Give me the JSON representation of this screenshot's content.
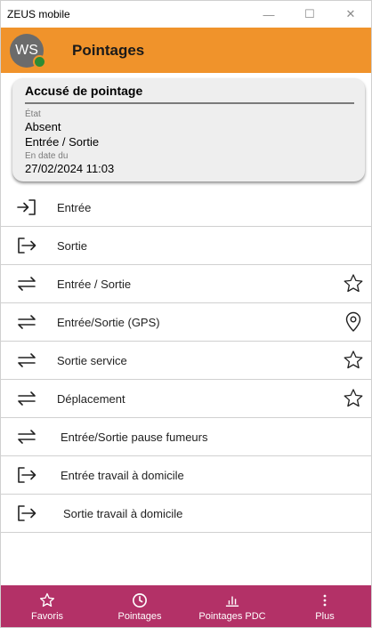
{
  "window": {
    "title": "ZEUS mobile",
    "controls": {
      "minimize": "—",
      "maximize": "☐",
      "close": "✕"
    }
  },
  "header": {
    "avatar_initials": "WS",
    "title": "Pointages",
    "bg_color": "#f0932b",
    "presence_color": "#2e8b33"
  },
  "card": {
    "title": "Accusé de pointage",
    "etat_label": "État",
    "etat_value": "Absent",
    "type_value": "Entrée / Sortie",
    "date_label": "En date du",
    "date_value": "27/02/2024 11:03"
  },
  "actions": [
    {
      "label": "Entrée",
      "icon": "enter-icon",
      "trailing": ""
    },
    {
      "label": "Sortie",
      "icon": "exit-icon",
      "trailing": ""
    },
    {
      "label": "Entrée / Sortie",
      "icon": "swap-icon",
      "trailing": "star-icon"
    },
    {
      "label": "Entrée/Sortie (GPS)",
      "icon": "swap-icon",
      "trailing": "location-pin-icon"
    },
    {
      "label": "Sortie service",
      "icon": "swap-icon",
      "trailing": "star-icon"
    },
    {
      "label": "Déplacement",
      "icon": "swap-icon",
      "trailing": "star-icon"
    },
    {
      "label": "Entrée/Sortie pause fumeurs",
      "icon": "swap-icon",
      "trailing": ""
    },
    {
      "label": "Entrée travail à domicile",
      "icon": "exit-icon",
      "trailing": ""
    },
    {
      "label": "Sortie travail à domicile",
      "icon": "exit-icon",
      "trailing": ""
    }
  ],
  "bottom_nav": {
    "bg_color": "#b33167",
    "items": [
      {
        "label": "Favoris",
        "icon": "star-icon"
      },
      {
        "label": "Pointages",
        "icon": "clock-icon"
      },
      {
        "label": "Pointages PDC",
        "icon": "bar-chart-icon"
      },
      {
        "label": "Plus",
        "icon": "more-vertical-icon"
      }
    ]
  }
}
